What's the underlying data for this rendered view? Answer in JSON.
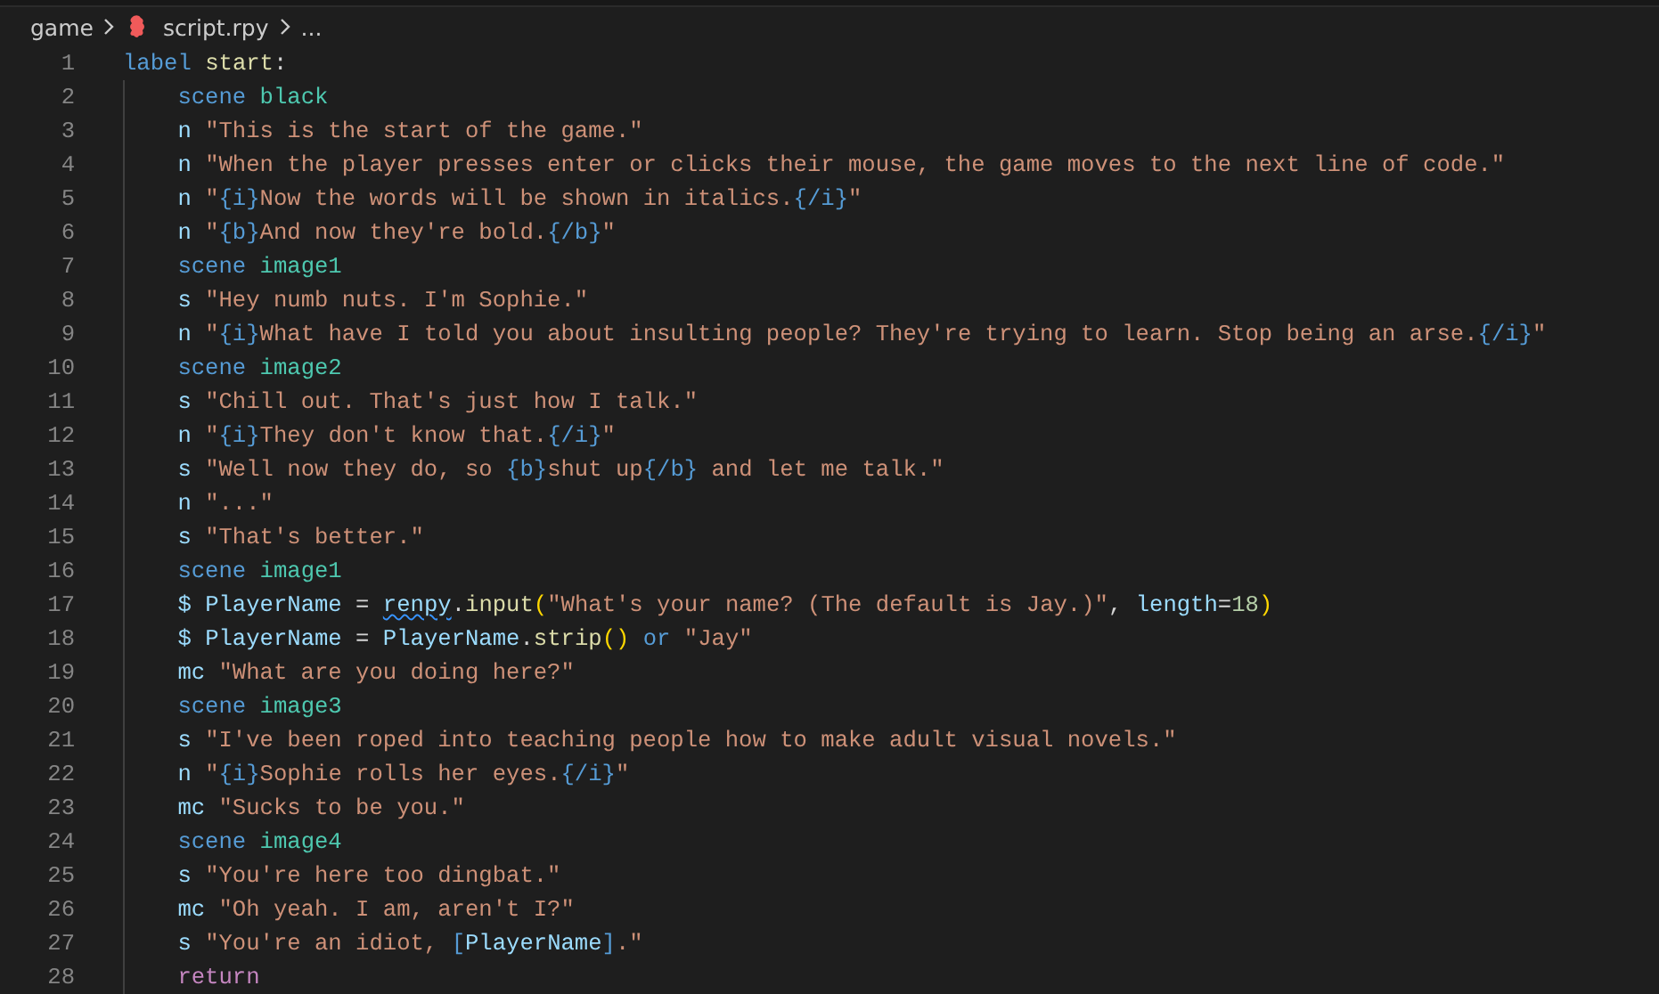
{
  "breadcrumb": {
    "folder": "game",
    "file": "script.rpy",
    "symbol": "..."
  },
  "lines": [
    {
      "number": "1",
      "indented": false,
      "tokens": [
        {
          "kind": "keyword",
          "text": "label"
        },
        {
          "kind": "function",
          "text": "start",
          "gap_before": true
        },
        {
          "kind": "plain",
          "text": ":"
        }
      ]
    },
    {
      "number": "2",
      "indented": true,
      "tokens": [
        {
          "kind": "keyword",
          "text": "scene"
        },
        {
          "kind": "entity",
          "text": "black",
          "gap_before": true
        }
      ]
    },
    {
      "number": "3",
      "indented": true,
      "tokens": [
        {
          "kind": "variable",
          "text": "n"
        },
        {
          "kind": "string",
          "text": "\"This is the start of the game.\"",
          "gap_before": true
        }
      ]
    },
    {
      "number": "4",
      "indented": true,
      "tokens": [
        {
          "kind": "variable",
          "text": "n"
        },
        {
          "kind": "string",
          "text": "\"When the player presses enter or clicks their mouse, the game moves to the next line of code.\"",
          "gap_before": true
        }
      ]
    },
    {
      "number": "5",
      "indented": true,
      "tokens": [
        {
          "kind": "variable",
          "text": "n"
        },
        {
          "kind": "string",
          "text": "\"",
          "gap_before": true
        },
        {
          "kind": "tag",
          "text": "{i}"
        },
        {
          "kind": "string",
          "text": "Now the words will be shown in italics."
        },
        {
          "kind": "tag",
          "text": "{/i}"
        },
        {
          "kind": "string",
          "text": "\""
        }
      ]
    },
    {
      "number": "6",
      "indented": true,
      "tokens": [
        {
          "kind": "variable",
          "text": "n"
        },
        {
          "kind": "string",
          "text": "\"",
          "gap_before": true
        },
        {
          "kind": "tag",
          "text": "{b}"
        },
        {
          "kind": "string",
          "text": "And now they're bold."
        },
        {
          "kind": "tag",
          "text": "{/b}"
        },
        {
          "kind": "string",
          "text": "\""
        }
      ]
    },
    {
      "number": "7",
      "indented": true,
      "tokens": [
        {
          "kind": "keyword",
          "text": "scene"
        },
        {
          "kind": "entity",
          "text": "image1",
          "gap_before": true
        }
      ]
    },
    {
      "number": "8",
      "indented": true,
      "tokens": [
        {
          "kind": "variable",
          "text": "s"
        },
        {
          "kind": "string",
          "text": "\"Hey numb nuts. I'm Sophie.\"",
          "gap_before": true
        }
      ]
    },
    {
      "number": "9",
      "indented": true,
      "tokens": [
        {
          "kind": "variable",
          "text": "n"
        },
        {
          "kind": "string",
          "text": "\"",
          "gap_before": true
        },
        {
          "kind": "tag",
          "text": "{i}"
        },
        {
          "kind": "string",
          "text": "What have I told you about insulting people? They're trying to learn. Stop being an arse."
        },
        {
          "kind": "tag",
          "text": "{/i}"
        },
        {
          "kind": "string",
          "text": "\""
        }
      ]
    },
    {
      "number": "10",
      "indented": true,
      "tokens": [
        {
          "kind": "keyword",
          "text": "scene"
        },
        {
          "kind": "entity",
          "text": "image2",
          "gap_before": true
        }
      ]
    },
    {
      "number": "11",
      "indented": true,
      "tokens": [
        {
          "kind": "variable",
          "text": "s"
        },
        {
          "kind": "string",
          "text": "\"Chill out. That's just how I talk.\"",
          "gap_before": true
        }
      ]
    },
    {
      "number": "12",
      "indented": true,
      "tokens": [
        {
          "kind": "variable",
          "text": "n"
        },
        {
          "kind": "string",
          "text": "\"",
          "gap_before": true
        },
        {
          "kind": "tag",
          "text": "{i}"
        },
        {
          "kind": "string",
          "text": "They don't know that."
        },
        {
          "kind": "tag",
          "text": "{/i}"
        },
        {
          "kind": "string",
          "text": "\""
        }
      ]
    },
    {
      "number": "13",
      "indented": true,
      "tokens": [
        {
          "kind": "variable",
          "text": "s"
        },
        {
          "kind": "string",
          "text": "\"Well now they do, so",
          "gap_before": true
        },
        {
          "kind": "tag",
          "text": "{b}",
          "gap_before": true
        },
        {
          "kind": "string",
          "text": "shut up"
        },
        {
          "kind": "tag",
          "text": "{/b}"
        },
        {
          "kind": "string",
          "text": "and let me talk.\"",
          "gap_before": true
        }
      ]
    },
    {
      "number": "14",
      "indented": true,
      "tokens": [
        {
          "kind": "variable",
          "text": "n"
        },
        {
          "kind": "string",
          "text": "\"...\"",
          "gap_before": true
        }
      ]
    },
    {
      "number": "15",
      "indented": true,
      "tokens": [
        {
          "kind": "variable",
          "text": "s"
        },
        {
          "kind": "string",
          "text": "\"That's better.\"",
          "gap_before": true
        }
      ]
    },
    {
      "number": "16",
      "indented": true,
      "tokens": [
        {
          "kind": "keyword",
          "text": "scene"
        },
        {
          "kind": "entity",
          "text": "image1",
          "gap_before": true
        }
      ]
    },
    {
      "number": "17",
      "indented": true,
      "tokens": [
        {
          "kind": "variable",
          "text": "$"
        },
        {
          "kind": "variable",
          "text": "PlayerName",
          "gap_before": true
        },
        {
          "kind": "plain",
          "text": "=",
          "gap_before": true
        },
        {
          "kind": "variable",
          "text": "renpy",
          "gap_before": true,
          "squiggle": true
        },
        {
          "kind": "plain",
          "text": "."
        },
        {
          "kind": "function",
          "text": "input"
        },
        {
          "kind": "bracket",
          "text": "("
        },
        {
          "kind": "string",
          "text": "\"What's your name? (The default is Jay.)\""
        },
        {
          "kind": "plain",
          "text": ","
        },
        {
          "kind": "variable",
          "text": "length",
          "gap_before": true
        },
        {
          "kind": "plain",
          "text": "="
        },
        {
          "kind": "number",
          "text": "18"
        },
        {
          "kind": "bracket",
          "text": ")"
        }
      ]
    },
    {
      "number": "18",
      "indented": true,
      "tokens": [
        {
          "kind": "variable",
          "text": "$"
        },
        {
          "kind": "variable",
          "text": "PlayerName",
          "gap_before": true
        },
        {
          "kind": "plain",
          "text": "=",
          "gap_before": true
        },
        {
          "kind": "variable",
          "text": "PlayerName",
          "gap_before": true
        },
        {
          "kind": "plain",
          "text": "."
        },
        {
          "kind": "function",
          "text": "strip"
        },
        {
          "kind": "bracket",
          "text": "()"
        },
        {
          "kind": "keyword",
          "text": "or",
          "gap_before": true
        },
        {
          "kind": "string",
          "text": "\"Jay\"",
          "gap_before": true
        }
      ]
    },
    {
      "number": "19",
      "indented": true,
      "tokens": [
        {
          "kind": "variable",
          "text": "mc"
        },
        {
          "kind": "string",
          "text": "\"What are you doing here?\"",
          "gap_before": true
        }
      ]
    },
    {
      "number": "20",
      "indented": true,
      "tokens": [
        {
          "kind": "keyword",
          "text": "scene"
        },
        {
          "kind": "entity",
          "text": "image3",
          "gap_before": true
        }
      ]
    },
    {
      "number": "21",
      "indented": true,
      "tokens": [
        {
          "kind": "variable",
          "text": "s"
        },
        {
          "kind": "string",
          "text": "\"I've been roped into teaching people how to make adult visual novels.\"",
          "gap_before": true
        }
      ]
    },
    {
      "number": "22",
      "indented": true,
      "tokens": [
        {
          "kind": "variable",
          "text": "n"
        },
        {
          "kind": "string",
          "text": "\"",
          "gap_before": true
        },
        {
          "kind": "tag",
          "text": "{i}"
        },
        {
          "kind": "string",
          "text": "Sophie rolls her eyes."
        },
        {
          "kind": "tag",
          "text": "{/i}"
        },
        {
          "kind": "string",
          "text": "\""
        }
      ]
    },
    {
      "number": "23",
      "indented": true,
      "tokens": [
        {
          "kind": "variable",
          "text": "mc"
        },
        {
          "kind": "string",
          "text": "\"Sucks to be you.\"",
          "gap_before": true
        }
      ]
    },
    {
      "number": "24",
      "indented": true,
      "tokens": [
        {
          "kind": "keyword",
          "text": "scene"
        },
        {
          "kind": "entity",
          "text": "image4",
          "gap_before": true
        }
      ]
    },
    {
      "number": "25",
      "indented": true,
      "tokens": [
        {
          "kind": "variable",
          "text": "s"
        },
        {
          "kind": "string",
          "text": "\"You're here too dingbat.\"",
          "gap_before": true
        }
      ]
    },
    {
      "number": "26",
      "indented": true,
      "tokens": [
        {
          "kind": "variable",
          "text": "mc"
        },
        {
          "kind": "string",
          "text": "\"Oh yeah. I am, aren't I?\"",
          "gap_before": true
        }
      ]
    },
    {
      "number": "27",
      "indented": true,
      "tokens": [
        {
          "kind": "variable",
          "text": "s"
        },
        {
          "kind": "string",
          "text": "\"You're an idiot,",
          "gap_before": true
        },
        {
          "kind": "tag",
          "text": "[",
          "gap_before": true
        },
        {
          "kind": "variable",
          "text": "PlayerName"
        },
        {
          "kind": "tag",
          "text": "]"
        },
        {
          "kind": "string",
          "text": ".\""
        }
      ]
    },
    {
      "number": "28",
      "indented": true,
      "tokens": [
        {
          "kind": "control",
          "text": "return"
        }
      ]
    }
  ]
}
